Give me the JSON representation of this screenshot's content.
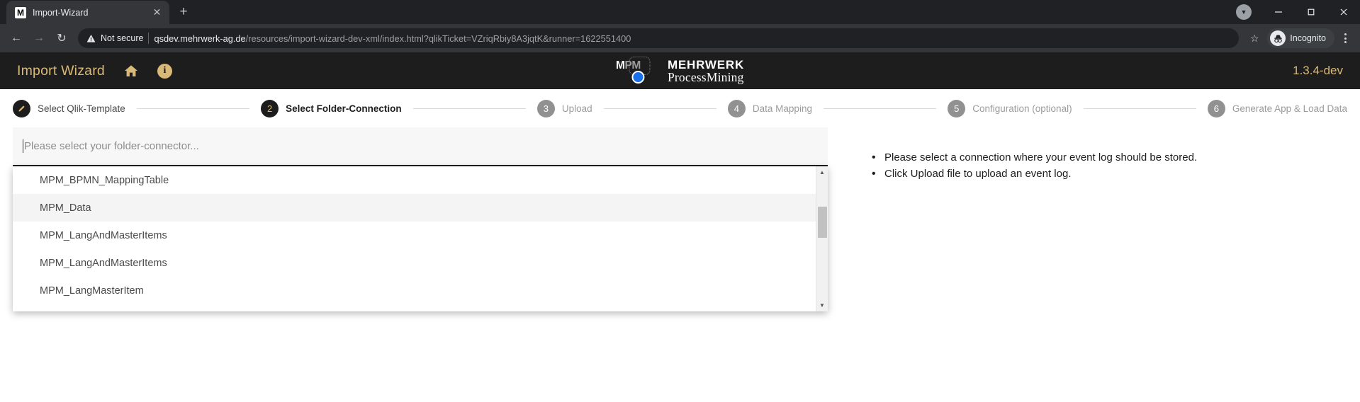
{
  "browser": {
    "tab": {
      "favicon_letter": "M",
      "title": "Import-Wizard",
      "close_icon": "✕"
    },
    "new_tab_icon": "+",
    "window_controls": {
      "profile_icon": "▼",
      "minimize": "—",
      "maximize": "❐",
      "close": "✕"
    },
    "nav": {
      "back_icon": "←",
      "forward_icon": "→",
      "reload_icon": "↻"
    },
    "omnibox": {
      "warning_icon": "⚠",
      "security_label": "Not secure",
      "url_host": "qsdev.mehrwerk-ag.de",
      "url_path": "/resources/import-wizard-dev-xml/index.html?qlikTicket=VZriqRbiy8A3jqtK&runner=1622551400"
    },
    "bookmark_icon": "☆",
    "incognito_label": "Incognito",
    "menu_icon": "kebab-menu"
  },
  "header": {
    "title": "Import Wizard",
    "home_icon": "home",
    "info_icon": "i",
    "logo": {
      "mark_m": "M",
      "mark_pm": "PM",
      "line1": "MEHRWERK",
      "line2": "ProcessMining"
    },
    "version": "1.3.4-dev",
    "accent_color": "#d9b978",
    "background_color": "#1d1d1d"
  },
  "stepper": {
    "steps": [
      {
        "number": "1",
        "badge": "pencil",
        "label": "Select Qlik-Template",
        "state": "done"
      },
      {
        "number": "2",
        "badge": "2",
        "label": "Select Folder-Connection",
        "state": "active"
      },
      {
        "number": "3",
        "badge": "3",
        "label": "Upload",
        "state": "todo"
      },
      {
        "number": "4",
        "badge": "4",
        "label": "Data Mapping",
        "state": "todo"
      },
      {
        "number": "5",
        "badge": "5",
        "label": "Configuration (optional)",
        "state": "todo"
      },
      {
        "number": "6",
        "badge": "6",
        "label": "Generate App & Load Data",
        "state": "todo"
      }
    ]
  },
  "main": {
    "connector_select": {
      "placeholder": "Please select your folder-connector...",
      "value": "",
      "options": [
        {
          "label": "MPM_BPMN_MappingTable",
          "hovered": false
        },
        {
          "label": "MPM_Data",
          "hovered": true
        },
        {
          "label": "MPM_LangAndMasterItems",
          "hovered": false
        },
        {
          "label": "MPM_LangAndMasterItems",
          "hovered": false
        },
        {
          "label": "MPM_LangMasterItem",
          "hovered": false
        }
      ],
      "scroll_up_icon": "▲",
      "scroll_down_icon": "▼"
    },
    "hints": [
      "Please select a connection where your event log should be stored.",
      "Click Upload file to upload an event log."
    ]
  }
}
